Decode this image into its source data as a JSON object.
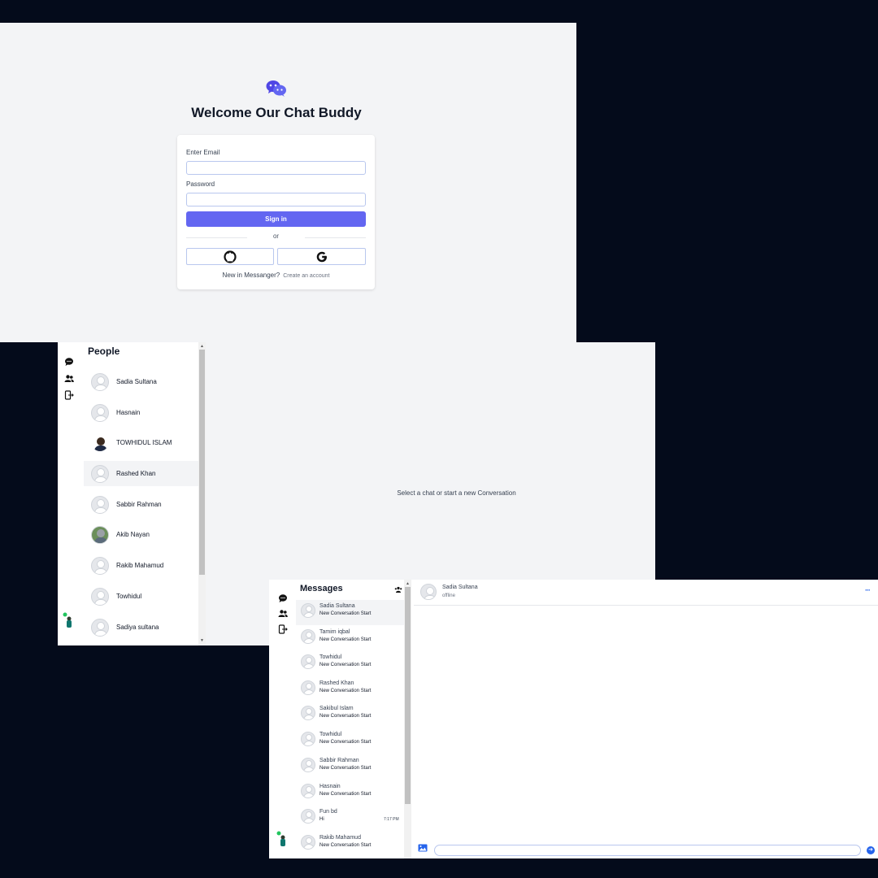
{
  "login": {
    "title": "Welcome Our Chat Buddy",
    "email_label": "Enter Email",
    "password_label": "Password",
    "signin_label": "Sign in",
    "or_text": "or",
    "new_text": "New in Messanger?",
    "create_account": "Create an account",
    "accent_color": "#6366f1"
  },
  "sidebar_icons": [
    "chat-icon",
    "people-icon",
    "logout-icon"
  ],
  "people": {
    "heading": "People",
    "items": [
      {
        "name": "Sadia Sultana",
        "avatar": "default"
      },
      {
        "name": "Hasnain",
        "avatar": "default"
      },
      {
        "name": "TOWHIDUL ISLAM",
        "avatar": "photo"
      },
      {
        "name": "Rashed Khan",
        "avatar": "default"
      },
      {
        "name": "Sabbir Rahman",
        "avatar": "default"
      },
      {
        "name": "Akib Nayan",
        "avatar": "photo"
      },
      {
        "name": "Rakib Mahamud",
        "avatar": "default"
      },
      {
        "name": "Towhidul",
        "avatar": "default"
      },
      {
        "name": "Sadiya sultana",
        "avatar": "default"
      }
    ],
    "empty_state": "Select a chat or start a new Conversation"
  },
  "messages": {
    "heading": "Messages",
    "items": [
      {
        "name": "Sadia Sultana",
        "preview": "New Conversation Start",
        "time": ""
      },
      {
        "name": "Tamim iqbal",
        "preview": "New Conversation Start",
        "time": ""
      },
      {
        "name": "Towhidul",
        "preview": "New Conversation Start",
        "time": ""
      },
      {
        "name": "Rashed Khan",
        "preview": "New Conversation Start",
        "time": ""
      },
      {
        "name": "Sakibul Islam",
        "preview": "New Conversation Start",
        "time": ""
      },
      {
        "name": "Towhidul",
        "preview": "New Conversation Start",
        "time": ""
      },
      {
        "name": "Sabbir Rahman",
        "preview": "New Conversation Start",
        "time": ""
      },
      {
        "name": "Hasnain",
        "preview": "New Conversation Start",
        "time": ""
      },
      {
        "name": "Fun bd",
        "preview": "Hi",
        "time": "7:17 PM"
      },
      {
        "name": "Rakib Mahamud",
        "preview": "New Conversation Start",
        "time": ""
      }
    ]
  },
  "chat": {
    "user_name": "Sadia Sultana",
    "status": "offline",
    "menu": "···",
    "send_glyph": "➜"
  }
}
